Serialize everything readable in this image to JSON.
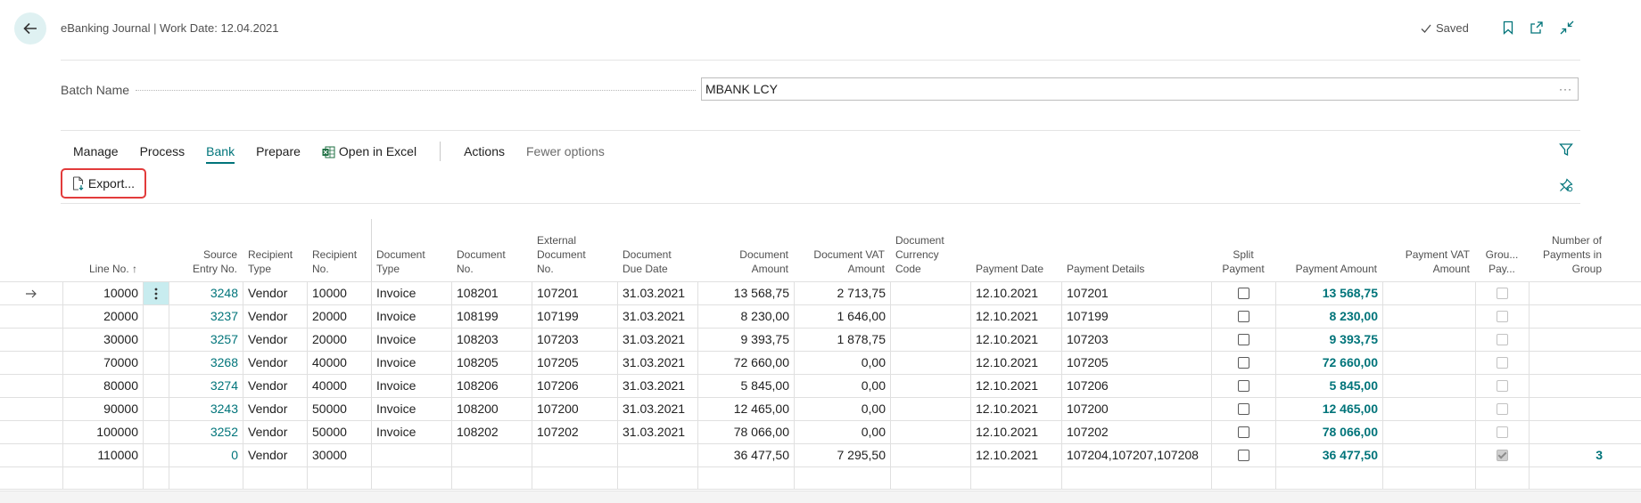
{
  "header": {
    "title": "eBanking Journal | Work Date: 12.04.2021",
    "saved_label": "Saved"
  },
  "batch": {
    "label": "Batch Name",
    "value": "MBANK LCY",
    "more": "···"
  },
  "menu": {
    "items": [
      "Manage",
      "Process",
      "Bank",
      "Prepare",
      "Open in Excel",
      "Actions",
      "Fewer options"
    ],
    "active": "Bank"
  },
  "action": {
    "export_label": "Export..."
  },
  "grid": {
    "columns": [
      {
        "key": "line_no",
        "lines": [
          "Line No. ↑"
        ]
      },
      {
        "key": "source_entry",
        "lines": [
          "Source",
          "Entry No."
        ]
      },
      {
        "key": "recipient_type",
        "lines": [
          "Recipient",
          "Type"
        ]
      },
      {
        "key": "recipient_no",
        "lines": [
          "Recipient",
          "No."
        ]
      },
      {
        "key": "doc_type",
        "lines": [
          "Document",
          "Type"
        ]
      },
      {
        "key": "doc_no",
        "lines": [
          "Document",
          "No."
        ]
      },
      {
        "key": "ext_doc_no",
        "lines": [
          "External",
          "Document",
          "No."
        ]
      },
      {
        "key": "doc_due",
        "lines": [
          "Document",
          "Due Date"
        ]
      },
      {
        "key": "doc_amount",
        "lines": [
          "Document",
          "Amount"
        ]
      },
      {
        "key": "doc_vat",
        "lines": [
          "Document VAT",
          "Amount"
        ]
      },
      {
        "key": "doc_cur",
        "lines": [
          "Document",
          "Currency",
          "Code"
        ]
      },
      {
        "key": "pay_date",
        "lines": [
          "Payment Date"
        ]
      },
      {
        "key": "pay_details",
        "lines": [
          "Payment Details"
        ]
      },
      {
        "key": "split",
        "lines": [
          "Split",
          "Payment"
        ]
      },
      {
        "key": "pay_amount",
        "lines": [
          "Payment Amount"
        ]
      },
      {
        "key": "pay_vat",
        "lines": [
          "Payment VAT",
          "Amount"
        ]
      },
      {
        "key": "group_pay",
        "lines": [
          "Grou...",
          "Pay..."
        ]
      },
      {
        "key": "num_payments",
        "lines": [
          "Number of",
          "Payments in",
          "Group"
        ]
      }
    ],
    "rows": [
      {
        "line_no": "10000",
        "source_entry": "3248",
        "recipient_type": "Vendor",
        "recipient_no": "10000",
        "doc_type": "Invoice",
        "doc_no": "108201",
        "ext_doc_no": "107201",
        "doc_due": "31.03.2021",
        "doc_amount": "13 568,75",
        "doc_vat": "2 713,75",
        "doc_cur": "",
        "pay_date": "12.10.2021",
        "pay_details": "107201",
        "split": false,
        "pay_amount": "13 568,75",
        "pay_vat": "",
        "group_pay": false,
        "num_payments": "",
        "current": true
      },
      {
        "line_no": "20000",
        "source_entry": "3237",
        "recipient_type": "Vendor",
        "recipient_no": "20000",
        "doc_type": "Invoice",
        "doc_no": "108199",
        "ext_doc_no": "107199",
        "doc_due": "31.03.2021",
        "doc_amount": "8 230,00",
        "doc_vat": "1 646,00",
        "doc_cur": "",
        "pay_date": "12.10.2021",
        "pay_details": "107199",
        "split": false,
        "pay_amount": "8 230,00",
        "pay_vat": "",
        "group_pay": false,
        "num_payments": ""
      },
      {
        "line_no": "30000",
        "source_entry": "3257",
        "recipient_type": "Vendor",
        "recipient_no": "20000",
        "doc_type": "Invoice",
        "doc_no": "108203",
        "ext_doc_no": "107203",
        "doc_due": "31.03.2021",
        "doc_amount": "9 393,75",
        "doc_vat": "1 878,75",
        "doc_cur": "",
        "pay_date": "12.10.2021",
        "pay_details": "107203",
        "split": false,
        "pay_amount": "9 393,75",
        "pay_vat": "",
        "group_pay": false,
        "num_payments": ""
      },
      {
        "line_no": "70000",
        "source_entry": "3268",
        "recipient_type": "Vendor",
        "recipient_no": "40000",
        "doc_type": "Invoice",
        "doc_no": "108205",
        "ext_doc_no": "107205",
        "doc_due": "31.03.2021",
        "doc_amount": "72 660,00",
        "doc_vat": "0,00",
        "doc_cur": "",
        "pay_date": "12.10.2021",
        "pay_details": "107205",
        "split": false,
        "pay_amount": "72 660,00",
        "pay_vat": "",
        "group_pay": false,
        "num_payments": ""
      },
      {
        "line_no": "80000",
        "source_entry": "3274",
        "recipient_type": "Vendor",
        "recipient_no": "40000",
        "doc_type": "Invoice",
        "doc_no": "108206",
        "ext_doc_no": "107206",
        "doc_due": "31.03.2021",
        "doc_amount": "5 845,00",
        "doc_vat": "0,00",
        "doc_cur": "",
        "pay_date": "12.10.2021",
        "pay_details": "107206",
        "split": false,
        "pay_amount": "5 845,00",
        "pay_vat": "",
        "group_pay": false,
        "num_payments": ""
      },
      {
        "line_no": "90000",
        "source_entry": "3243",
        "recipient_type": "Vendor",
        "recipient_no": "50000",
        "doc_type": "Invoice",
        "doc_no": "108200",
        "ext_doc_no": "107200",
        "doc_due": "31.03.2021",
        "doc_amount": "12 465,00",
        "doc_vat": "0,00",
        "doc_cur": "",
        "pay_date": "12.10.2021",
        "pay_details": "107200",
        "split": false,
        "pay_amount": "12 465,00",
        "pay_vat": "",
        "group_pay": false,
        "num_payments": ""
      },
      {
        "line_no": "100000",
        "source_entry": "3252",
        "recipient_type": "Vendor",
        "recipient_no": "50000",
        "doc_type": "Invoice",
        "doc_no": "108202",
        "ext_doc_no": "107202",
        "doc_due": "31.03.2021",
        "doc_amount": "78 066,00",
        "doc_vat": "0,00",
        "doc_cur": "",
        "pay_date": "12.10.2021",
        "pay_details": "107202",
        "split": false,
        "pay_amount": "78 066,00",
        "pay_vat": "",
        "group_pay": false,
        "num_payments": ""
      },
      {
        "line_no": "110000",
        "source_entry": "0",
        "recipient_type": "Vendor",
        "recipient_no": "30000",
        "doc_type": "",
        "doc_no": "",
        "ext_doc_no": "",
        "doc_due": "",
        "doc_amount": "36 477,50",
        "doc_vat": "7 295,50",
        "doc_cur": "",
        "pay_date": "12.10.2021",
        "pay_details": "107204,107207,107208",
        "split": false,
        "pay_amount": "36 477,50",
        "pay_vat": "",
        "group_pay": true,
        "num_payments": "3"
      },
      {
        "line_no": "",
        "source_entry": "",
        "recipient_type": "",
        "recipient_no": "",
        "doc_type": "",
        "doc_no": "",
        "ext_doc_no": "",
        "doc_due": "",
        "doc_amount": "",
        "doc_vat": "",
        "doc_cur": "",
        "pay_date": "",
        "pay_details": "",
        "split": null,
        "pay_amount": "",
        "pay_vat": "",
        "group_pay": null,
        "num_payments": "",
        "empty": true
      }
    ]
  },
  "colors": {
    "accent": "#00747a",
    "highlight": "#e23b3b",
    "selected_cell": "#c8ecef"
  }
}
